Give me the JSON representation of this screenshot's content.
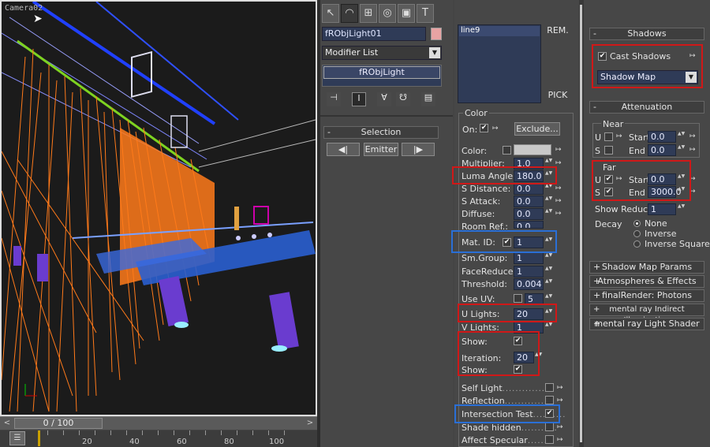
{
  "viewport": {
    "label": "Camera02"
  },
  "timeline": {
    "position": "0 / 100",
    "left_arrow": "<",
    "right_arrow": ">",
    "ticks": [
      "20",
      "40",
      "60",
      "80",
      "100"
    ]
  },
  "command_panel": {
    "tabs": [
      "create",
      "modify",
      "hierarchy",
      "motion",
      "display",
      "utilities"
    ],
    "object_name": "fRObjLight01",
    "object_color": "#e8a3a3",
    "modifier_list": "Modifier List",
    "stack_item": "fRObjLight",
    "selection": {
      "title": "Selection",
      "emitter": "Emitter",
      "prev": "◀|",
      "next": "|▶"
    }
  },
  "light_panel": {
    "list_item": "line9",
    "rem_button": "REM.",
    "pick_button": "PICK",
    "color_group": "Color",
    "on_label": "On:",
    "exclude_button": "Exclude...",
    "params": [
      {
        "label": "Color:",
        "value": ""
      },
      {
        "label": "Multiplier:",
        "value": "1.0"
      },
      {
        "label": "Luma Angle:",
        "value": "180.0"
      },
      {
        "label": "S Distance:",
        "value": "0.0"
      },
      {
        "label": "S Attack:",
        "value": "0.0"
      },
      {
        "label": "Diffuse:",
        "value": "0.0"
      },
      {
        "label": "Room Ref.:",
        "value": "0.0"
      },
      {
        "label": "Mat. ID:",
        "value": "1"
      },
      {
        "label": "Sm.Group:",
        "value": "1"
      },
      {
        "label": "FaceReduce:",
        "value": "1"
      },
      {
        "label": "Threshold:",
        "value": "0.004"
      },
      {
        "label": "Use UV:",
        "value": "5"
      },
      {
        "label": "U Lights:",
        "value": "20"
      },
      {
        "label": "V Lights:",
        "value": "1"
      },
      {
        "label": "Show:",
        "value": ""
      },
      {
        "label": "Iteration:",
        "value": "20"
      },
      {
        "label": "Show:",
        "value": ""
      }
    ],
    "options": [
      {
        "label": "Self Light",
        "dots": "...............",
        "checked": false
      },
      {
        "label": "Reflection",
        "dots": "...............",
        "checked": false
      },
      {
        "label": "Intersection Test",
        "dots": "..........",
        "checked": true
      },
      {
        "label": "Shade hidden",
        "dots": "...........",
        "checked": false
      },
      {
        "label": "Affect Specular",
        "dots": "........",
        "checked": false
      }
    ]
  },
  "shadows": {
    "title": "Shadows",
    "cast_shadows": "Cast Shadows",
    "shadow_type": "Shadow Map",
    "attenuation_title": "Attenuation",
    "near_label": "Near",
    "far_label": "Far",
    "u_label": "U",
    "s_label": "S",
    "start_label": "Start",
    "end_label": "End",
    "near_start": "0.0",
    "near_end": "0.0",
    "far_start": "0.0",
    "far_end": "3000.0",
    "show_reduce_label": "Show Reduce",
    "show_reduce_value": "1",
    "decay_label": "Decay",
    "decay_options": [
      "None",
      "Inverse",
      "Inverse Square"
    ],
    "rollouts": [
      "Shadow Map Params",
      "Atmospheres & Effects",
      "finalRender: Photons",
      "mental ray Indirect Illumination",
      "mental ray Light Shader"
    ]
  },
  "colors": {
    "highlight_red": "#d01818",
    "highlight_blue": "#2a6fd6",
    "wire_orange": "#ff7a1a"
  }
}
